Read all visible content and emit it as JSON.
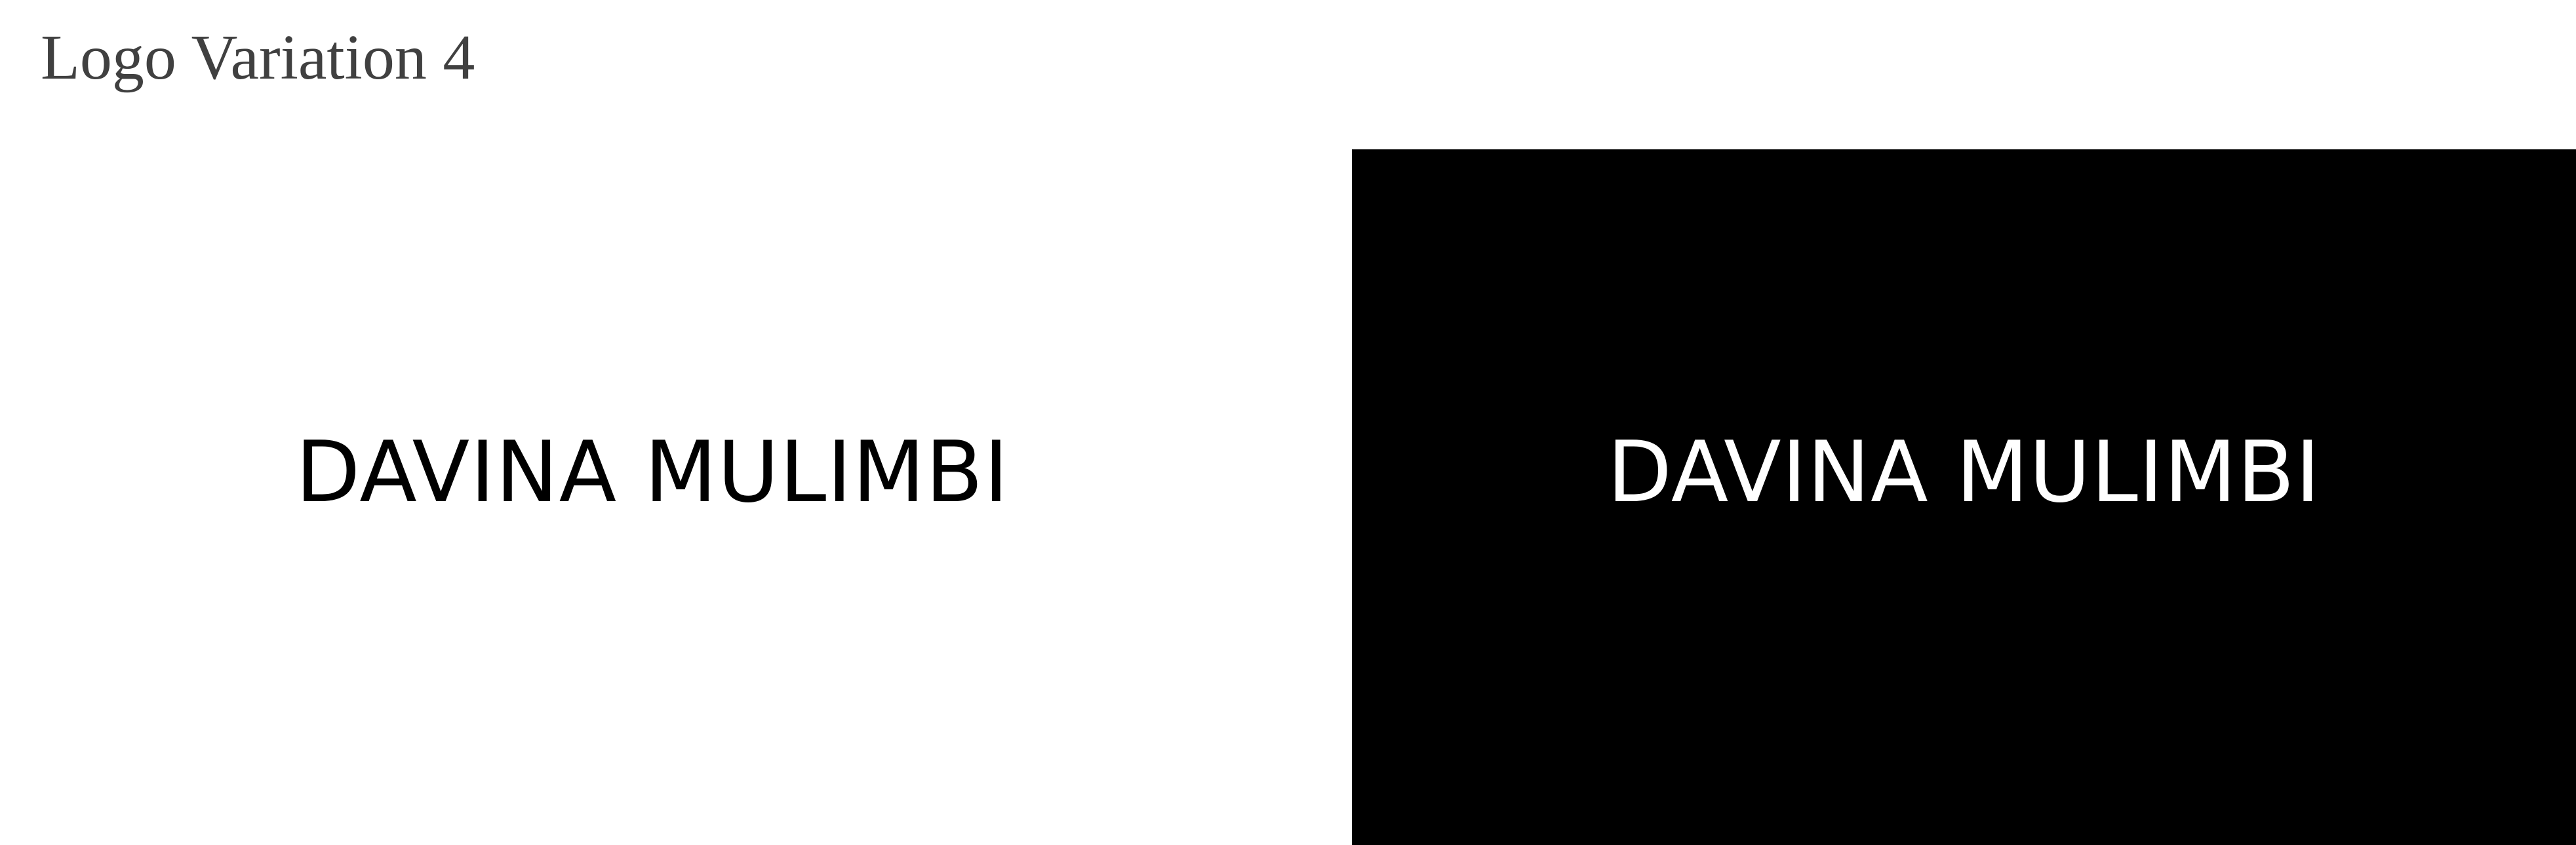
{
  "page": {
    "title": "Logo Variation 4"
  },
  "logos": {
    "light": {
      "wordmark": "DAVINA MULIMBI",
      "background_color": "#ffffff",
      "text_color": "#000000"
    },
    "dark": {
      "wordmark": "DAVINA MULIMBI",
      "background_color": "#000000",
      "text_color": "#ffffff"
    }
  }
}
